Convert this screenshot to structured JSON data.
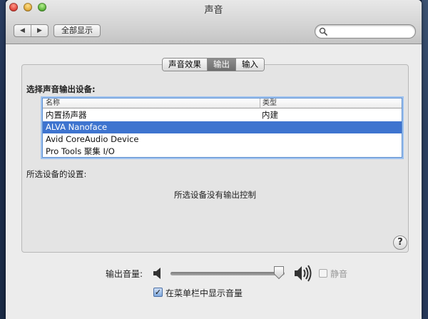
{
  "window": {
    "title": "声音"
  },
  "toolbar": {
    "show_all_label": "全部显示",
    "back_glyph": "◀",
    "forward_glyph": "▶",
    "search_placeholder": ""
  },
  "tabs": [
    {
      "label": "声音效果",
      "active": false
    },
    {
      "label": "输出",
      "active": true
    },
    {
      "label": "输入",
      "active": false
    }
  ],
  "output": {
    "select_device_label": "选择声音输出设备:",
    "table": {
      "columns": [
        "名称",
        "类型"
      ],
      "rows": [
        {
          "name": "内置扬声器",
          "type": "内建",
          "selected": false
        },
        {
          "name": "ALVA Nanoface",
          "type": "",
          "selected": true
        },
        {
          "name": "Avid CoreAudio Device",
          "type": "",
          "selected": false
        },
        {
          "name": "Pro Tools 聚集 I/O",
          "type": "",
          "selected": false
        }
      ]
    },
    "device_settings_label": "所选设备的设置:",
    "no_controls_message": "所选设备没有输出控制",
    "help_glyph": "?"
  },
  "volume": {
    "label": "输出音量:",
    "level": 0.95,
    "mute_label": "静音",
    "mute_checked": false,
    "mute_enabled": false,
    "show_in_menubar_label": "在菜单栏中显示音量",
    "show_in_menubar_checked": true
  },
  "colors": {
    "selection": "#3e74cf",
    "window_bg": "#ececec",
    "panel_bg": "#e4e4e4"
  }
}
